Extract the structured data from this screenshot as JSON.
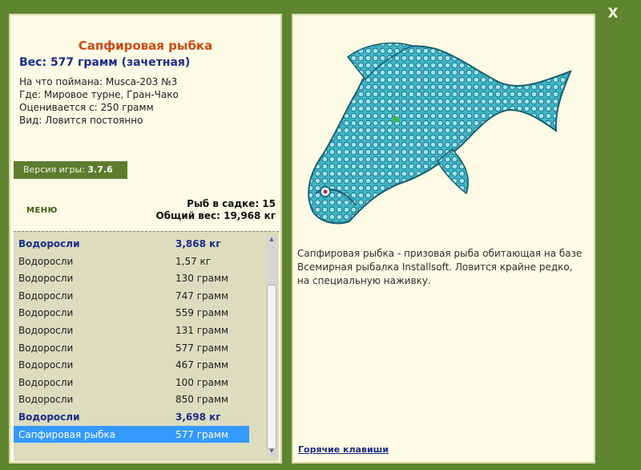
{
  "window": {
    "close_label": "X"
  },
  "fish": {
    "title": "Сапфировая рыбка",
    "weight": "Вес: 577 грамм (зачетная)",
    "caught_on": "На что поймана: Musca-203 №3",
    "where": "Где: Мировое турне, Гран-Чако",
    "rated_from": "Оценивается с: 250 грамм",
    "kind": "Вид: Ловится постоянно"
  },
  "version": {
    "label": "Версия игры: ",
    "value": "3.7.6"
  },
  "menu_label": "МЕНЮ",
  "stats": {
    "count": "Рыб в садке: 15",
    "total_weight": "Общий вес: 19,968 кг"
  },
  "catch_list": [
    {
      "name": "Водоросли",
      "weight": "3,868 кг",
      "style": "bold"
    },
    {
      "name": "Водоросли",
      "weight": "1,57 кг",
      "style": "normal"
    },
    {
      "name": "Водоросли",
      "weight": "130 грамм",
      "style": "normal"
    },
    {
      "name": "Водоросли",
      "weight": "747 грамм",
      "style": "normal"
    },
    {
      "name": "Водоросли",
      "weight": "559 грамм",
      "style": "normal"
    },
    {
      "name": "Водоросли",
      "weight": "131 грамм",
      "style": "normal"
    },
    {
      "name": "Водоросли",
      "weight": "577 грамм",
      "style": "normal"
    },
    {
      "name": "Водоросли",
      "weight": "467 грамм",
      "style": "normal"
    },
    {
      "name": "Водоросли",
      "weight": "100 грамм",
      "style": "normal"
    },
    {
      "name": "Водоросли",
      "weight": "850 грамм",
      "style": "normal"
    },
    {
      "name": "Водоросли",
      "weight": "3,698 кг",
      "style": "bold"
    },
    {
      "name": "Сапфировая рыбка",
      "weight": "577 грамм",
      "style": "selected"
    }
  ],
  "description": "Сапфировая рыбка - призовая рыба обитающая на базе Всемирная рыбалка Installsoft. Ловится крайне редко, на специальную наживку.",
  "hotkeys_label": "Горячие клавиши",
  "colors": {
    "frame": "#5f8430",
    "panel": "#fdfbe5",
    "title": "#cc4b12",
    "weight": "#1a2c8a",
    "selection": "#3399ff",
    "fish": "#3fb6c9"
  }
}
